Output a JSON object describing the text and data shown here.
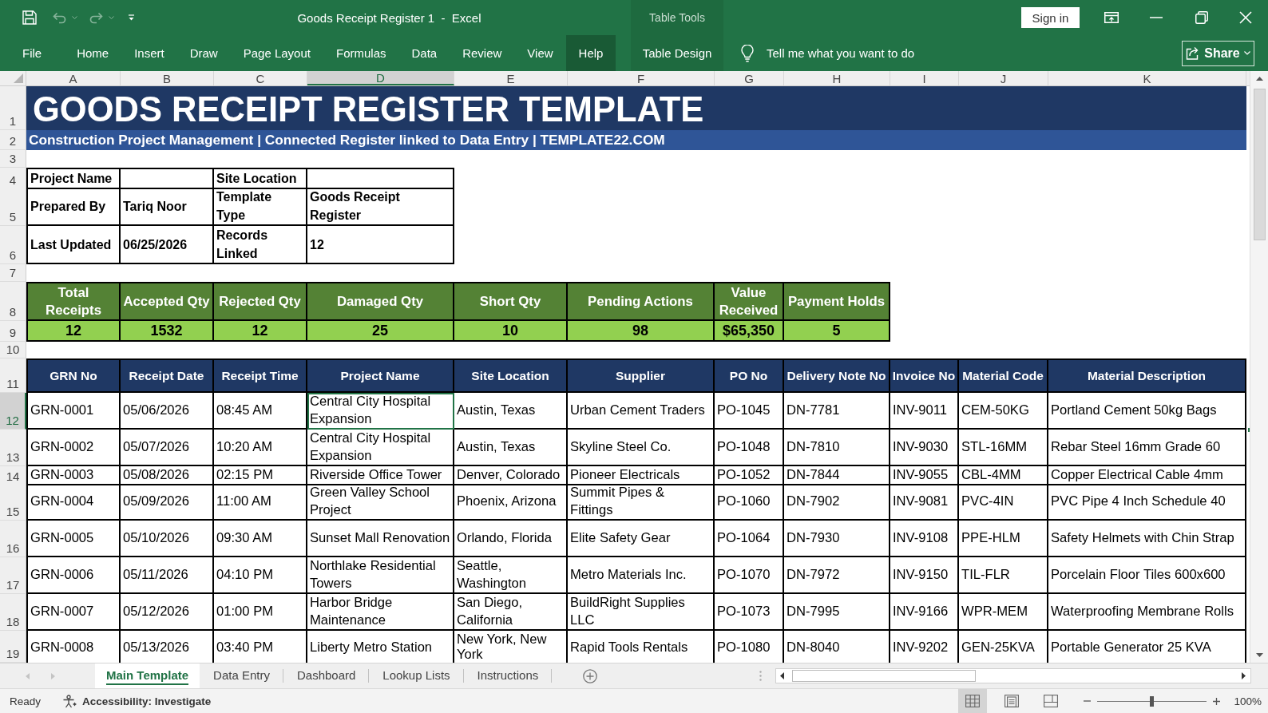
{
  "window": {
    "quick_access": [
      {
        "kind": "save",
        "disabled": false
      },
      {
        "kind": "undo",
        "disabled": true
      },
      {
        "kind": "redo",
        "disabled": true
      }
    ],
    "title": "Goods Receipt Register 1  -  Excel",
    "context_label": "Table Tools",
    "sign_in": "Sign in"
  },
  "ribbon": {
    "tabs": [
      {
        "label": "File",
        "selected": false
      },
      {
        "label": "Home",
        "selected": false
      },
      {
        "label": "Insert",
        "selected": false
      },
      {
        "label": "Draw",
        "selected": false
      },
      {
        "label": "Page Layout",
        "selected": false
      },
      {
        "label": "Formulas",
        "selected": false
      },
      {
        "label": "Data",
        "selected": false
      },
      {
        "label": "Review",
        "selected": false
      },
      {
        "label": "View",
        "selected": false
      },
      {
        "label": "Help",
        "selected": true
      }
    ],
    "context_tabs": [
      {
        "label": "Table Design",
        "selected": false
      }
    ],
    "tell_me": {
      "placeholder": "Tell me what you want to do"
    },
    "share": "Share"
  },
  "sheet": {
    "column_headers": [
      {
        "label": "A",
        "selected": false
      },
      {
        "label": "B",
        "selected": false
      },
      {
        "label": "C",
        "selected": false
      },
      {
        "label": "D",
        "selected": true
      },
      {
        "label": "E",
        "selected": false
      },
      {
        "label": "F",
        "selected": false
      },
      {
        "label": "G",
        "selected": false
      },
      {
        "label": "H",
        "selected": false
      },
      {
        "label": "I",
        "selected": false
      },
      {
        "label": "J",
        "selected": false
      },
      {
        "label": "K",
        "selected": false
      }
    ],
    "row_headers": [
      {
        "label": "1",
        "selected": false
      },
      {
        "label": "2",
        "selected": false
      },
      {
        "label": "3",
        "selected": false
      },
      {
        "label": "4",
        "selected": false
      },
      {
        "label": "5",
        "selected": false
      },
      {
        "label": "6",
        "selected": false
      },
      {
        "label": "7",
        "selected": false
      },
      {
        "label": "8",
        "selected": false
      },
      {
        "label": "9",
        "selected": false
      },
      {
        "label": "10",
        "selected": false
      },
      {
        "label": "11",
        "selected": false
      },
      {
        "label": "12",
        "selected": true
      },
      {
        "label": "13",
        "selected": false
      },
      {
        "label": "14",
        "selected": false
      },
      {
        "label": "15",
        "selected": false
      },
      {
        "label": "16",
        "selected": false
      },
      {
        "label": "17",
        "selected": false
      },
      {
        "label": "18",
        "selected": false
      },
      {
        "label": "19",
        "selected": false
      }
    ],
    "title": "GOODS RECEIPT REGISTER TEMPLATE",
    "subtitle": "Construction Project Management | Connected Register linked to Data Entry | TEMPLATE22.COM",
    "info_table": {
      "rows": [
        {
          "cells": [
            {
              "kind": "label",
              "text": "Project Name"
            },
            {
              "kind": "empty"
            },
            {
              "kind": "label",
              "text": "Site Location"
            },
            {
              "kind": "empty"
            }
          ]
        },
        {
          "cells": [
            {
              "kind": "label",
              "text": "Prepared By"
            },
            {
              "kind": "value",
              "text": "Tariq Noor"
            },
            {
              "kind": "label",
              "text": "Template Type"
            },
            {
              "kind": "value",
              "text": "Goods Receipt Register"
            }
          ]
        },
        {
          "cells": [
            {
              "kind": "label",
              "text": "Last Updated"
            },
            {
              "kind": "value",
              "text": "06/25/2026"
            },
            {
              "kind": "label",
              "text": "Records Linked"
            },
            {
              "kind": "value",
              "text": "12"
            }
          ]
        }
      ]
    },
    "kpis": [
      {
        "label": "Total Receipts",
        "value": "12"
      },
      {
        "label": "Accepted Qty",
        "value": "1532"
      },
      {
        "label": "Rejected Qty",
        "value": "12"
      },
      {
        "label": "Damaged Qty",
        "value": "25"
      },
      {
        "label": "Short Qty",
        "value": "10"
      },
      {
        "label": "Pending Actions",
        "value": "98"
      },
      {
        "label": "Value Received",
        "value": "$65,350"
      },
      {
        "label": "Payment Holds",
        "value": "5"
      }
    ],
    "table": {
      "columns": [
        "GRN No",
        "Receipt Date",
        "Receipt Time",
        "Project Name",
        "Site Location",
        "Supplier",
        "PO No",
        "Delivery Note No",
        "Invoice No",
        "Material Code",
        "Material Description"
      ],
      "rows": [
        [
          "GRN-0001",
          "05/06/2026",
          "08:45 AM",
          "Central City Hospital Expansion",
          "Austin, Texas",
          "Urban Cement Traders",
          "PO-1045",
          "DN-7781",
          "INV-9011",
          "CEM-50KG",
          "Portland Cement 50kg Bags"
        ],
        [
          "GRN-0002",
          "05/07/2026",
          "10:20 AM",
          "Central City Hospital Expansion",
          "Austin, Texas",
          "Skyline Steel Co.",
          "PO-1048",
          "DN-7810",
          "INV-9030",
          "STL-16MM",
          "Rebar Steel 16mm Grade 60"
        ],
        [
          "GRN-0003",
          "05/08/2026",
          "02:15 PM",
          "Riverside Office Tower",
          "Denver, Colorado",
          "Pioneer Electricals",
          "PO-1052",
          "DN-7844",
          "INV-9055",
          "CBL-4MM",
          "Copper Electrical Cable 4mm"
        ],
        [
          "GRN-0004",
          "05/09/2026",
          "11:00 AM",
          "Green Valley School Project",
          "Phoenix, Arizona",
          "Summit Pipes & Fittings",
          "PO-1060",
          "DN-7902",
          "INV-9081",
          "PVC-4IN",
          "PVC Pipe 4 Inch Schedule 40"
        ],
        [
          "GRN-0005",
          "05/10/2026",
          "09:30 AM",
          "Sunset Mall Renovation",
          "Orlando, Florida",
          "Elite Safety Gear",
          "PO-1064",
          "DN-7930",
          "INV-9108",
          "PPE-HLM",
          "Safety Helmets with Chin Strap"
        ],
        [
          "GRN-0006",
          "05/11/2026",
          "04:10 PM",
          "Northlake Residential Towers",
          "Seattle, Washington",
          "Metro Materials Inc.",
          "PO-1070",
          "DN-7972",
          "INV-9150",
          "TIL-FLR",
          "Porcelain Floor Tiles 600x600"
        ],
        [
          "GRN-0007",
          "05/12/2026",
          "01:00 PM",
          "Harbor Bridge Maintenance",
          "San Diego, California",
          "BuildRight Supplies LLC",
          "PO-1073",
          "DN-7995",
          "INV-9166",
          "WPR-MEM",
          "Waterproofing Membrane Rolls"
        ],
        [
          "GRN-0008",
          "05/13/2026",
          "03:40 PM",
          "Liberty Metro Station",
          "New York, New York",
          "Rapid Tools Rentals",
          "PO-1080",
          "DN-8040",
          "INV-9202",
          "GEN-25KVA",
          "Portable Generator 25 KVA"
        ]
      ]
    }
  },
  "sheet_tabs": [
    {
      "label": "Main Template",
      "selected": true
    },
    {
      "label": "Data Entry",
      "selected": false
    },
    {
      "label": "Dashboard",
      "selected": false
    },
    {
      "label": "Lookup Lists",
      "selected": false
    },
    {
      "label": "Instructions",
      "selected": false
    }
  ],
  "status_bar": {
    "mode": "Ready",
    "accessibility": "Accessibility: Investigate",
    "views": [
      {
        "kind": "normal",
        "selected": true
      },
      {
        "kind": "page_layout",
        "selected": false
      },
      {
        "kind": "page_break_preview",
        "selected": false
      }
    ],
    "zoom_slider": {
      "level": 0.5
    },
    "zoom": "100%"
  }
}
